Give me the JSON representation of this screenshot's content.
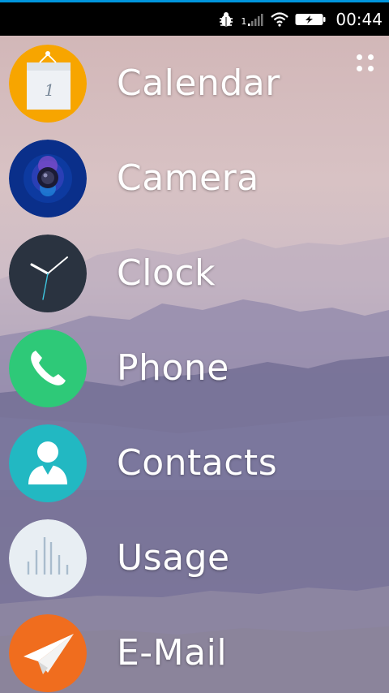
{
  "status_bar": {
    "sim_label": "1",
    "time": "00:44"
  },
  "apps": [
    {
      "label": "Calendar",
      "icon": "calendar-icon",
      "color": "#f7a500",
      "calendar_day": "1"
    },
    {
      "label": "Camera",
      "icon": "camera-icon",
      "color": "#0a2f8a"
    },
    {
      "label": "Clock",
      "icon": "clock-icon",
      "color": "#2a3340"
    },
    {
      "label": "Phone",
      "icon": "phone-icon",
      "color": "#2ec978"
    },
    {
      "label": "Contacts",
      "icon": "contacts-icon",
      "color": "#22b8c2"
    },
    {
      "label": "Usage",
      "icon": "usage-icon",
      "color": "#e8eef3"
    },
    {
      "label": "E-Mail",
      "icon": "email-icon",
      "color": "#f06d1e"
    }
  ],
  "colors": {
    "accent_line": "#0095dd",
    "status_bar_bg": "#000000",
    "label_text": "#ffffff"
  }
}
